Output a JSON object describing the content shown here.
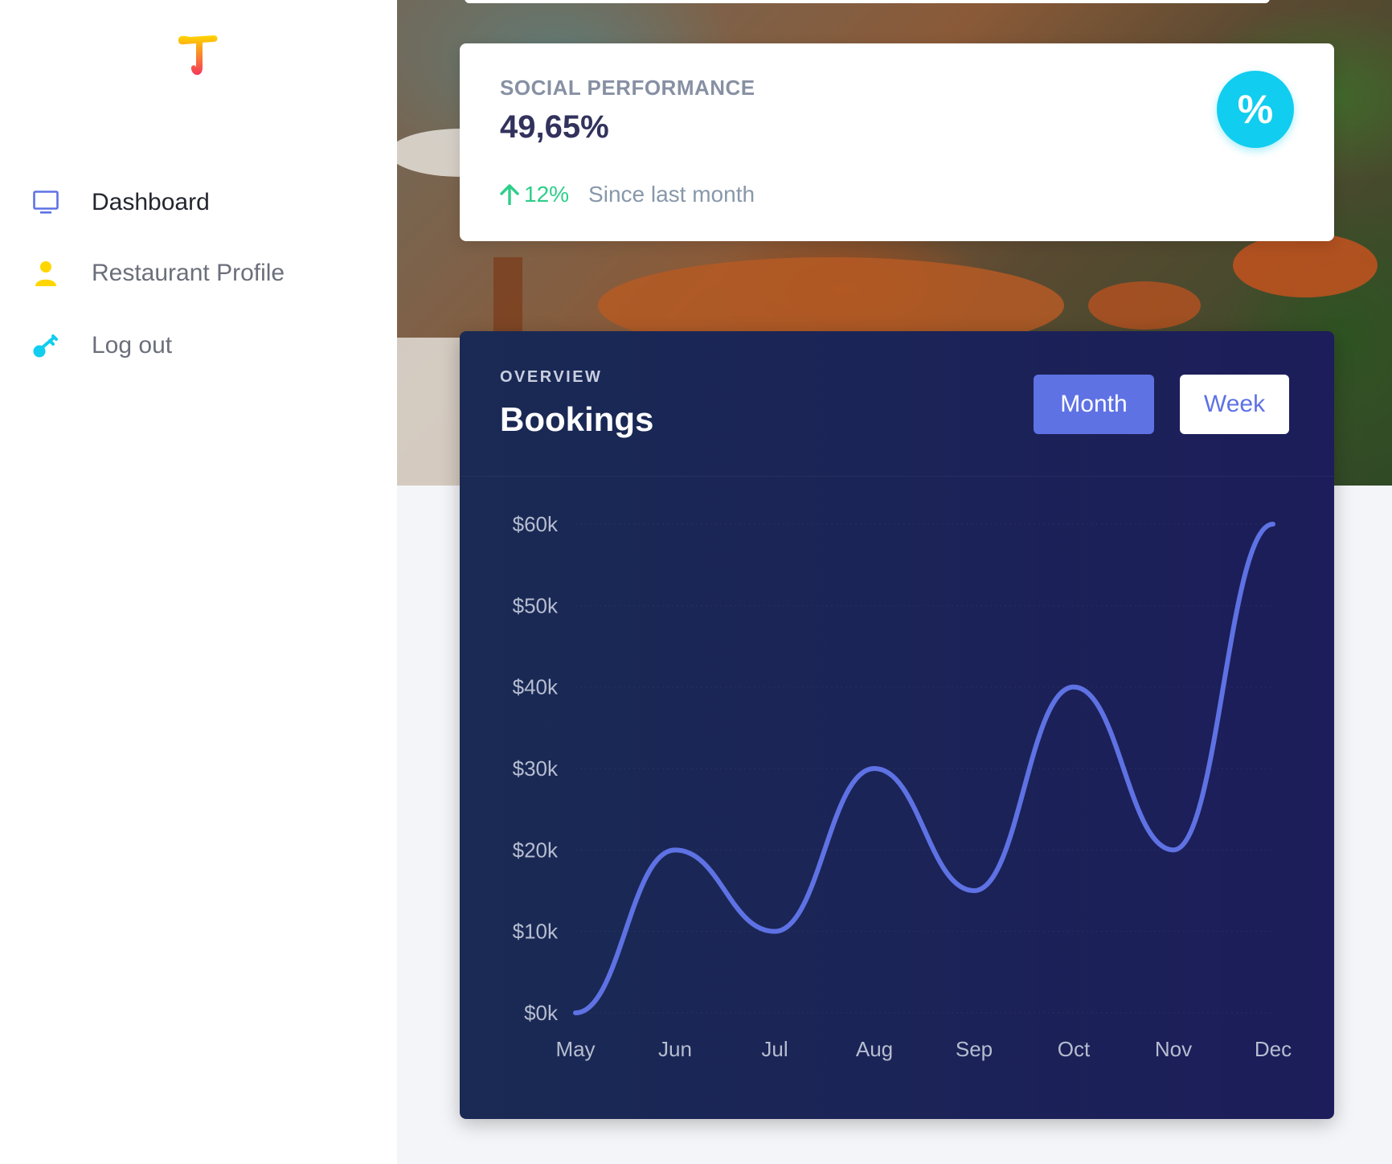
{
  "sidebar": {
    "items": [
      {
        "label": "Dashboard",
        "icon": "monitor-icon",
        "active": true,
        "color": "#5e72e4"
      },
      {
        "label": "Restaurant Profile",
        "icon": "user-icon",
        "active": false,
        "color": "#ffd600"
      },
      {
        "label": "Log out",
        "icon": "key-icon",
        "active": false,
        "color": "#11cdef"
      }
    ]
  },
  "stat_card": {
    "title": "SOCIAL PERFORMANCE",
    "value": "49,65%",
    "change": "12%",
    "since": "Since last month",
    "badge": "%",
    "badge_color": "#11cdef",
    "change_color": "#2dce89"
  },
  "chart_card": {
    "overline": "OVERVIEW",
    "title": "Bookings",
    "buttons": {
      "month": "Month",
      "week": "Week"
    }
  },
  "chart_data": {
    "type": "line",
    "title": "Bookings",
    "categories": [
      "May",
      "Jun",
      "Jul",
      "Aug",
      "Sep",
      "Oct",
      "Nov",
      "Dec"
    ],
    "series": [
      {
        "values": [
          0,
          20,
          10,
          30,
          15,
          40,
          20,
          60
        ],
        "color": "#5e72e4"
      }
    ],
    "y_ticks": [
      "$0k",
      "$10k",
      "$20k",
      "$30k",
      "$40k",
      "$50k",
      "$60k"
    ],
    "ylim": [
      0,
      60
    ],
    "grid": true
  }
}
